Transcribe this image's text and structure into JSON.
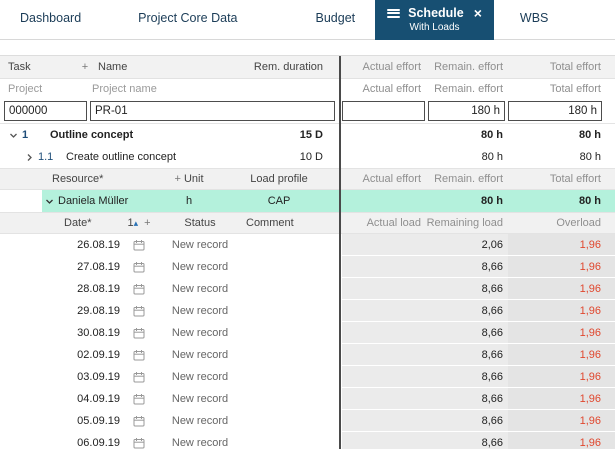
{
  "colors": {
    "accent": "#174f72",
    "highlight": "#b4f1dc",
    "overload_red": "#e0472e"
  },
  "tabs": [
    {
      "label": "Dashboard"
    },
    {
      "label": "Project Core Data"
    },
    {
      "label": "Budget"
    },
    {
      "label": "Schedule",
      "sublabel": "With Loads"
    },
    {
      "label": "WBS"
    }
  ],
  "grid": {
    "task_header": {
      "task": "Task",
      "add": "+",
      "name": "Name",
      "duration": "Rem. duration",
      "actual": "Actual effort",
      "remain": "Remain. effort",
      "total": "Total effort"
    },
    "project_header": {
      "id": "Project",
      "name": "Project name",
      "actual": "Actual effort",
      "remain": "Remain. effort",
      "total": "Total effort"
    },
    "project": {
      "id": "000000",
      "name": "PR-01",
      "actual": "",
      "remain": "180 h",
      "total": "180 h"
    },
    "tasks": [
      {
        "number": "1",
        "name": "Outline concept",
        "duration": "15 D",
        "remain": "80 h",
        "total": "80 h"
      },
      {
        "number": "1.1",
        "name": "Create outline concept",
        "duration": "10 D",
        "remain": "80 h",
        "total": "80 h"
      }
    ],
    "resource_header": {
      "resource": "Resource*",
      "add": "+",
      "unit": "Unit",
      "profile": "Load profile",
      "actual": "Actual effort",
      "remain": "Remain. effort",
      "total": "Total effort"
    },
    "resource": {
      "name": "Daniela Müller",
      "unit": "h",
      "profile": "CAP",
      "remain": "80 h",
      "total": "80 h"
    },
    "load_header": {
      "date": "Date*",
      "sort": "1",
      "sort_icon": "▴",
      "add": "+",
      "status": "Status",
      "comment": "Comment",
      "actual": "Actual load",
      "remaining": "Remaining load",
      "overload": "Overload"
    },
    "loads": [
      {
        "date": "26.08.19",
        "status": "New record",
        "remaining": "2,06",
        "overload": "1,96"
      },
      {
        "date": "27.08.19",
        "status": "New record",
        "remaining": "8,66",
        "overload": "1,96"
      },
      {
        "date": "28.08.19",
        "status": "New record",
        "remaining": "8,66",
        "overload": "1,96"
      },
      {
        "date": "29.08.19",
        "status": "New record",
        "remaining": "8,66",
        "overload": "1,96"
      },
      {
        "date": "30.08.19",
        "status": "New record",
        "remaining": "8,66",
        "overload": "1,96"
      },
      {
        "date": "02.09.19",
        "status": "New record",
        "remaining": "8,66",
        "overload": "1,96"
      },
      {
        "date": "03.09.19",
        "status": "New record",
        "remaining": "8,66",
        "overload": "1,96"
      },
      {
        "date": "04.09.19",
        "status": "New record",
        "remaining": "8,66",
        "overload": "1,96"
      },
      {
        "date": "05.09.19",
        "status": "New record",
        "remaining": "8,66",
        "overload": "1,96"
      },
      {
        "date": "06.09.19",
        "status": "New record",
        "remaining": "8,66",
        "overload": "1,96"
      }
    ]
  }
}
